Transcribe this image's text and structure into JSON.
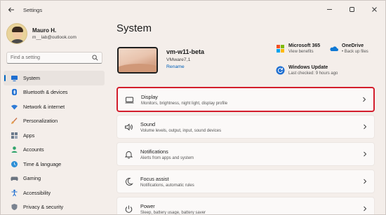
{
  "window": {
    "app_title": "Settings",
    "back_icon": "back-arrow-icon",
    "controls": [
      "minimize-icon",
      "maximize-icon",
      "close-icon"
    ]
  },
  "profile": {
    "name": "Mauro H.",
    "email": "m__lab@outlook.com"
  },
  "search": {
    "placeholder": "Find a setting"
  },
  "sidebar": {
    "items": [
      {
        "label": "System",
        "icon": "monitor-icon",
        "active": true
      },
      {
        "label": "Bluetooth & devices",
        "icon": "bluetooth-icon"
      },
      {
        "label": "Network & internet",
        "icon": "wifi-icon"
      },
      {
        "label": "Personalization",
        "icon": "brush-icon"
      },
      {
        "label": "Apps",
        "icon": "apps-grid-icon"
      },
      {
        "label": "Accounts",
        "icon": "person-icon"
      },
      {
        "label": "Time & language",
        "icon": "globe-clock-icon"
      },
      {
        "label": "Gaming",
        "icon": "gamepad-icon"
      },
      {
        "label": "Accessibility",
        "icon": "accessibility-icon"
      },
      {
        "label": "Privacy & security",
        "icon": "shield-icon"
      }
    ]
  },
  "main": {
    "title": "System",
    "device": {
      "name": "vm-w11-beta",
      "model": "VMware7,1",
      "rename": "Rename"
    },
    "quick_links": [
      {
        "title": "Microsoft 365",
        "sub": "View benefits",
        "icon": "microsoft-365-icon"
      },
      {
        "title": "OneDrive",
        "sub": "• Back up files",
        "icon": "onedrive-cloud-icon"
      },
      {
        "title": "Windows Update",
        "sub": "Last checked: 9 hours ago",
        "icon": "windows-update-icon"
      }
    ],
    "cards": [
      {
        "title": "Display",
        "sub": "Monitors, brightness, night light, display profile",
        "icon": "display-icon",
        "selected": true
      },
      {
        "title": "Sound",
        "sub": "Volume levels, output, input, sound devices",
        "icon": "speaker-icon"
      },
      {
        "title": "Notifications",
        "sub": "Alerts from apps and system",
        "icon": "bell-icon"
      },
      {
        "title": "Focus assist",
        "sub": "Notifications, automatic rules",
        "icon": "moon-icon"
      },
      {
        "title": "Power",
        "sub": "Sleep, battery usage, battery saver",
        "icon": "power-icon"
      }
    ]
  },
  "colors": {
    "accent": "#0067c0",
    "highlight_border": "#d31d2c",
    "window_bg": "#f4eeea",
    "card_bg": "#fbf9f8"
  }
}
